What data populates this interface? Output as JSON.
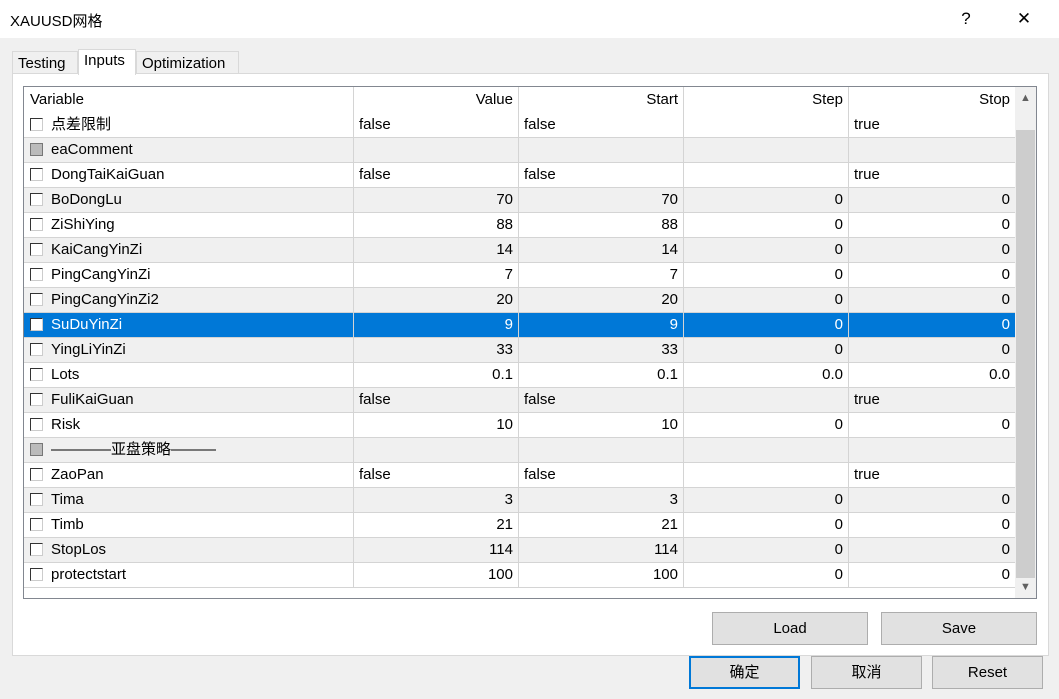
{
  "window": {
    "title": "XAUUSD网格",
    "help": "?",
    "close": "✕"
  },
  "tabs": [
    {
      "label": "Testing"
    },
    {
      "label": "Inputs"
    },
    {
      "label": "Optimization"
    }
  ],
  "columns": [
    "Variable",
    "Value",
    "Start",
    "Step",
    "Stop"
  ],
  "rows": [
    {
      "name": "点差限制",
      "value": "false",
      "start": "false",
      "step": "",
      "stop": "true",
      "type": "text",
      "disabled": false
    },
    {
      "name": "eaComment",
      "value": "",
      "start": "",
      "step": "",
      "stop": "",
      "type": "text",
      "disabled": true
    },
    {
      "name": "DongTaiKaiGuan",
      "value": "false",
      "start": "false",
      "step": "",
      "stop": "true",
      "type": "text",
      "disabled": false
    },
    {
      "name": "BoDongLu",
      "value": "70",
      "start": "70",
      "step": "0",
      "stop": "0",
      "type": "num",
      "disabled": false
    },
    {
      "name": "ZiShiYing",
      "value": "88",
      "start": "88",
      "step": "0",
      "stop": "0",
      "type": "num",
      "disabled": false
    },
    {
      "name": "KaiCangYinZi",
      "value": "14",
      "start": "14",
      "step": "0",
      "stop": "0",
      "type": "num",
      "disabled": false
    },
    {
      "name": "PingCangYinZi",
      "value": "7",
      "start": "7",
      "step": "0",
      "stop": "0",
      "type": "num",
      "disabled": false
    },
    {
      "name": "PingCangYinZi2",
      "value": "20",
      "start": "20",
      "step": "0",
      "stop": "0",
      "type": "num",
      "disabled": false
    },
    {
      "name": "SuDuYinZi",
      "value": "9",
      "start": "9",
      "step": "0",
      "stop": "0",
      "type": "num",
      "disabled": false,
      "selected": true
    },
    {
      "name": "YingLiYinZi",
      "value": "33",
      "start": "33",
      "step": "0",
      "stop": "0",
      "type": "num",
      "disabled": false
    },
    {
      "name": "Lots",
      "value": "0.1",
      "start": "0.1",
      "step": "0.0",
      "stop": "0.0",
      "type": "num",
      "disabled": false
    },
    {
      "name": "FuliKaiGuan",
      "value": "false",
      "start": "false",
      "step": "",
      "stop": "true",
      "type": "text",
      "disabled": false
    },
    {
      "name": "Risk",
      "value": "10",
      "start": "10",
      "step": "0",
      "stop": "0",
      "type": "num",
      "disabled": false
    },
    {
      "name": "————亚盘策略———",
      "value": "",
      "start": "",
      "step": "",
      "stop": "",
      "type": "text",
      "disabled": true
    },
    {
      "name": "ZaoPan",
      "value": "false",
      "start": "false",
      "step": "",
      "stop": "true",
      "type": "text",
      "disabled": false
    },
    {
      "name": "Tima",
      "value": "3",
      "start": "3",
      "step": "0",
      "stop": "0",
      "type": "num",
      "disabled": false
    },
    {
      "name": "Timb",
      "value": "21",
      "start": "21",
      "step": "0",
      "stop": "0",
      "type": "num",
      "disabled": false
    },
    {
      "name": "StopLos",
      "value": "114",
      "start": "114",
      "step": "0",
      "stop": "0",
      "type": "num",
      "disabled": false
    },
    {
      "name": "protectstart",
      "value": "100",
      "start": "100",
      "step": "0",
      "stop": "0",
      "type": "num",
      "disabled": false
    }
  ],
  "buttons": {
    "load": "Load",
    "save": "Save",
    "ok": "确定",
    "cancel": "取消",
    "reset": "Reset"
  },
  "colors": {
    "selection": "#0078d7"
  }
}
